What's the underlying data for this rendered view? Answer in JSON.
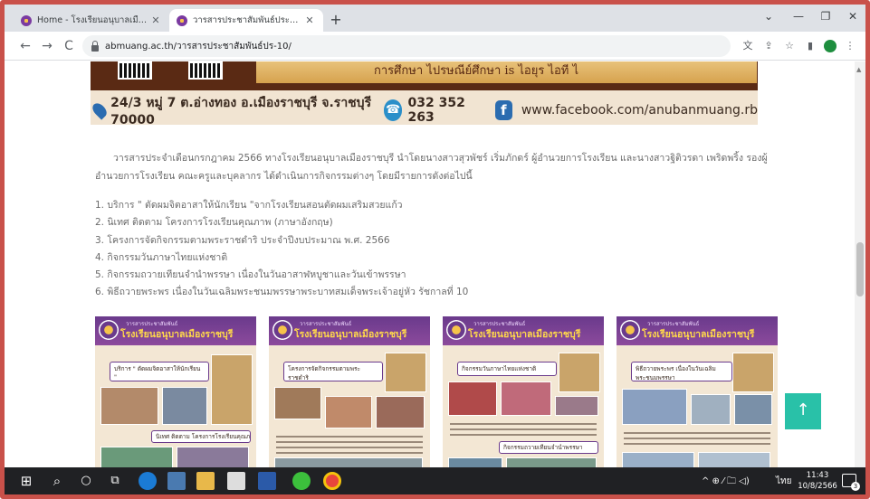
{
  "browser": {
    "tabs": [
      {
        "title": "Home - โรงเรียนอนุบาลเมืองราชบุรี",
        "active": false
      },
      {
        "title": "วารสารประชาสัมพันธ์ประจำเดือนกรก",
        "active": true
      }
    ],
    "new_tab": "+",
    "address": "abmuang.ac.th/วารสารประชาสัมพันธ์ปร-10/",
    "window_controls": {
      "chevron": "⌄",
      "minimize": "—",
      "maximize": "❐",
      "close": "✕"
    },
    "nav": {
      "back": "←",
      "forward": "→",
      "reload": "C"
    },
    "toolbar_icons": {
      "translate": "文",
      "share": "⇪",
      "bookmark": "☆",
      "sidepanel": "▮",
      "menu": "⋮"
    }
  },
  "page": {
    "banner": {
      "top_text": "การศึกษา ไปรษณีย์ศึกษา is ไอยุร ไอที ไ",
      "address": "24/3 หมู่ 7 ต.อ่างทอง อ.เมืองราชบุรี จ.ราชบุรี 70000",
      "phone": "032 352 263",
      "facebook": "www.facebook.com/anubanmuang.rb",
      "fb_glyph": "f",
      "phone_glyph": "☎"
    },
    "intro": "วารสารประจำเดือนกรกฎาคม 2566 ทางโรงเรียนอนุบาลเมืองราชบุรี นำโดยนางสาวสุวพัชร์ เริ่มภักดร์ ผู้อำนวยการโรงเรียน และนางสาวฐิติวรดา เพริดพริ้ง รองผู้อำนวยการโรงเรียน คณะครูและบุคลากร ได้ดำเนินการกิจกรรมต่างๆ โดยมีรายการดังต่อไปนี้",
    "items": [
      "1. บริการ \" ตัดผมจิตอาสาให้นักเรียน \"จากโรงเรียนสอนตัดผมเสริมสวยแก้ว",
      "2. นิเทศ ติดตาม โครงการโรงเรียนคุณภาพ (ภาษาอังกฤษ)",
      "3. โครงการจัดกิจกรรมตามพระราชดำริ ประจำปีงบประมาณ พ.ศ. 2566",
      "4. กิจกรรมวันภาษาไทยแห่งชาติ",
      "5. กิจกรรมถวายเทียนจำนำพรรษา เนื่องในวันอาสาฬหบูชาและวันเข้าพรรษา",
      "6. พิธีถวายพระพร เนื่องในวันเฉลิมพระชนมพรรษาพระบาทสมเด็จพระเจ้าอยู่หัว รัชกาลที่ 10"
    ],
    "cards": [
      {
        "header_sub": "วารสารประชาสัมพันธ์",
        "header_title": "โรงเรียนอนุบาลเมืองราชบุรี",
        "caption": "บริการ \" ตัดผมจิตอาสาให้นักเรียน \"",
        "caption2": "นิเทศ ติดตาม โครงการโรงเรียนคุณภาพ"
      },
      {
        "header_sub": "วารสารประชาสัมพันธ์",
        "header_title": "โรงเรียนอนุบาลเมืองราชบุรี",
        "caption": "โครงการจัดกิจกรรมตามพระราชดำริ",
        "caption2": ""
      },
      {
        "header_sub": "วารสารประชาสัมพันธ์",
        "header_title": "โรงเรียนอนุบาลเมืองราชบุรี",
        "caption": "กิจกรรมวันภาษาไทยแห่งชาติ",
        "caption2": "กิจกรรมถวายเทียนจำนำพรรษา"
      },
      {
        "header_sub": "วารสารประชาสัมพันธ์",
        "header_title": "โรงเรียนอนุบาลเมืองราชบุรี",
        "caption": "พิธีถวายพระพร เนื่องในวันเฉลิมพระชนมพรรษา",
        "caption2": ""
      }
    ],
    "scroll_top_glyph": "↑"
  },
  "taskbar": {
    "start_glyph": "⊞",
    "search_glyph": "⌕",
    "cortana_glyph": "○",
    "taskview_glyph": "⧉",
    "tray_glyphs": "^ ⊕ ⁄ 🗀 ◁)",
    "lang": "ไทย",
    "time": "11:43",
    "date": "10/8/2566",
    "notif_count": "3"
  }
}
